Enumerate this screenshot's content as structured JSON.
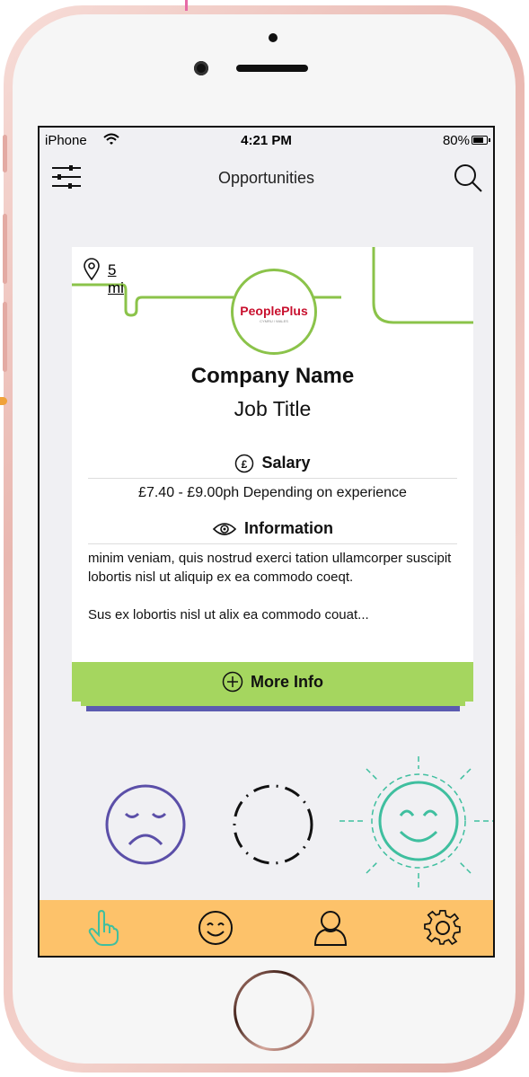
{
  "status_bar": {
    "carrier": "iPhone",
    "time": "4:21 PM",
    "battery": "80%",
    "battery_level": 0.8
  },
  "nav": {
    "title": "Opportunities",
    "left_icon": "filter-sliders-icon",
    "right_icon": "search-icon"
  },
  "card": {
    "distance": "5 mi",
    "logo_text": "PeoplePlus",
    "logo_subtext": "CYMRU / WALES",
    "company_name": "Company Name",
    "job_title": "Job Title",
    "salary_heading": "Salary",
    "salary_text": "£7.40 - £9.00ph Depending on experience",
    "info_heading": "Information",
    "info_paragraph_1": "minim veniam, quis nostrud exerci tation ullamcorper suscipit lobortis nisl ut aliquip ex ea commodo coeqt.",
    "info_paragraph_2": "Sus ex lobortis nisl ut alix ea commodo couat...",
    "more_info_label": "More Info"
  },
  "stack_colors": [
    "#f27a9b",
    "#a5d65f",
    "#5b5bb0"
  ],
  "reactions": {
    "sad_icon": "sad-face-icon",
    "neutral_icon": "dashed-circle-icon",
    "happy_icon": "happy-sun-face-icon",
    "colors": {
      "sad": "#5b4fa8",
      "neutral": "#111111",
      "happy": "#3fbf9f"
    }
  },
  "tabbar": {
    "background": "#fdc26a",
    "tabs": [
      {
        "icon": "hand-pointer-icon",
        "active": true,
        "color": "#3fbf9f"
      },
      {
        "icon": "smiley-icon",
        "active": false
      },
      {
        "icon": "user-icon",
        "active": false
      },
      {
        "icon": "gear-icon",
        "active": false
      }
    ]
  },
  "colors": {
    "accent_green": "#a5d65f",
    "line_green": "#8bc34a"
  }
}
